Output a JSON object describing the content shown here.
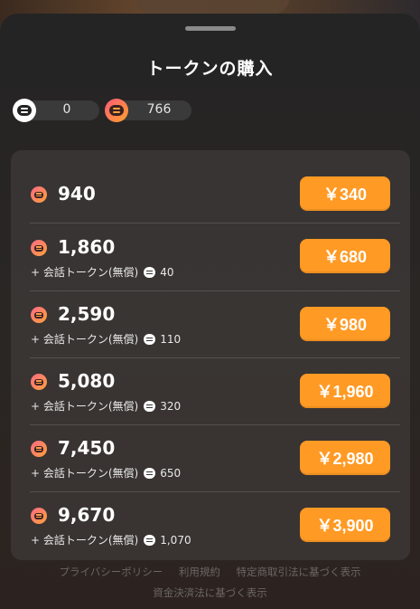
{
  "sheet": {
    "title": "トークンの購入"
  },
  "balances": [
    {
      "icon": "chat-token-icon",
      "value": "0"
    },
    {
      "icon": "premium-token-icon",
      "value": "766"
    }
  ],
  "packages": [
    {
      "amount": "940",
      "bonus_label": "",
      "bonus_value": "",
      "price": "￥340"
    },
    {
      "amount": "1,860",
      "bonus_label": "+ 会話トークン(無償)",
      "bonus_value": "40",
      "price": "￥680"
    },
    {
      "amount": "2,590",
      "bonus_label": "+ 会話トークン(無償)",
      "bonus_value": "110",
      "price": "￥980"
    },
    {
      "amount": "5,080",
      "bonus_label": "+ 会話トークン(無償)",
      "bonus_value": "320",
      "price": "￥1,960"
    },
    {
      "amount": "7,450",
      "bonus_label": "+ 会話トークン(無償)",
      "bonus_value": "650",
      "price": "￥2,980"
    },
    {
      "amount": "9,670",
      "bonus_label": "+ 会話トークン(無償)",
      "bonus_value": "1,070",
      "price": "￥3,900"
    }
  ],
  "footer": {
    "privacy": "プライバシーポリシー",
    "terms": "利用規約",
    "commercial": "特定商取引法に基づく表示",
    "payment": "資金決済法に基づく表示"
  },
  "colors": {
    "accent": "#ff9a24",
    "token_gradient_start": "#ff6a86",
    "token_gradient_end": "#ffa23a"
  }
}
